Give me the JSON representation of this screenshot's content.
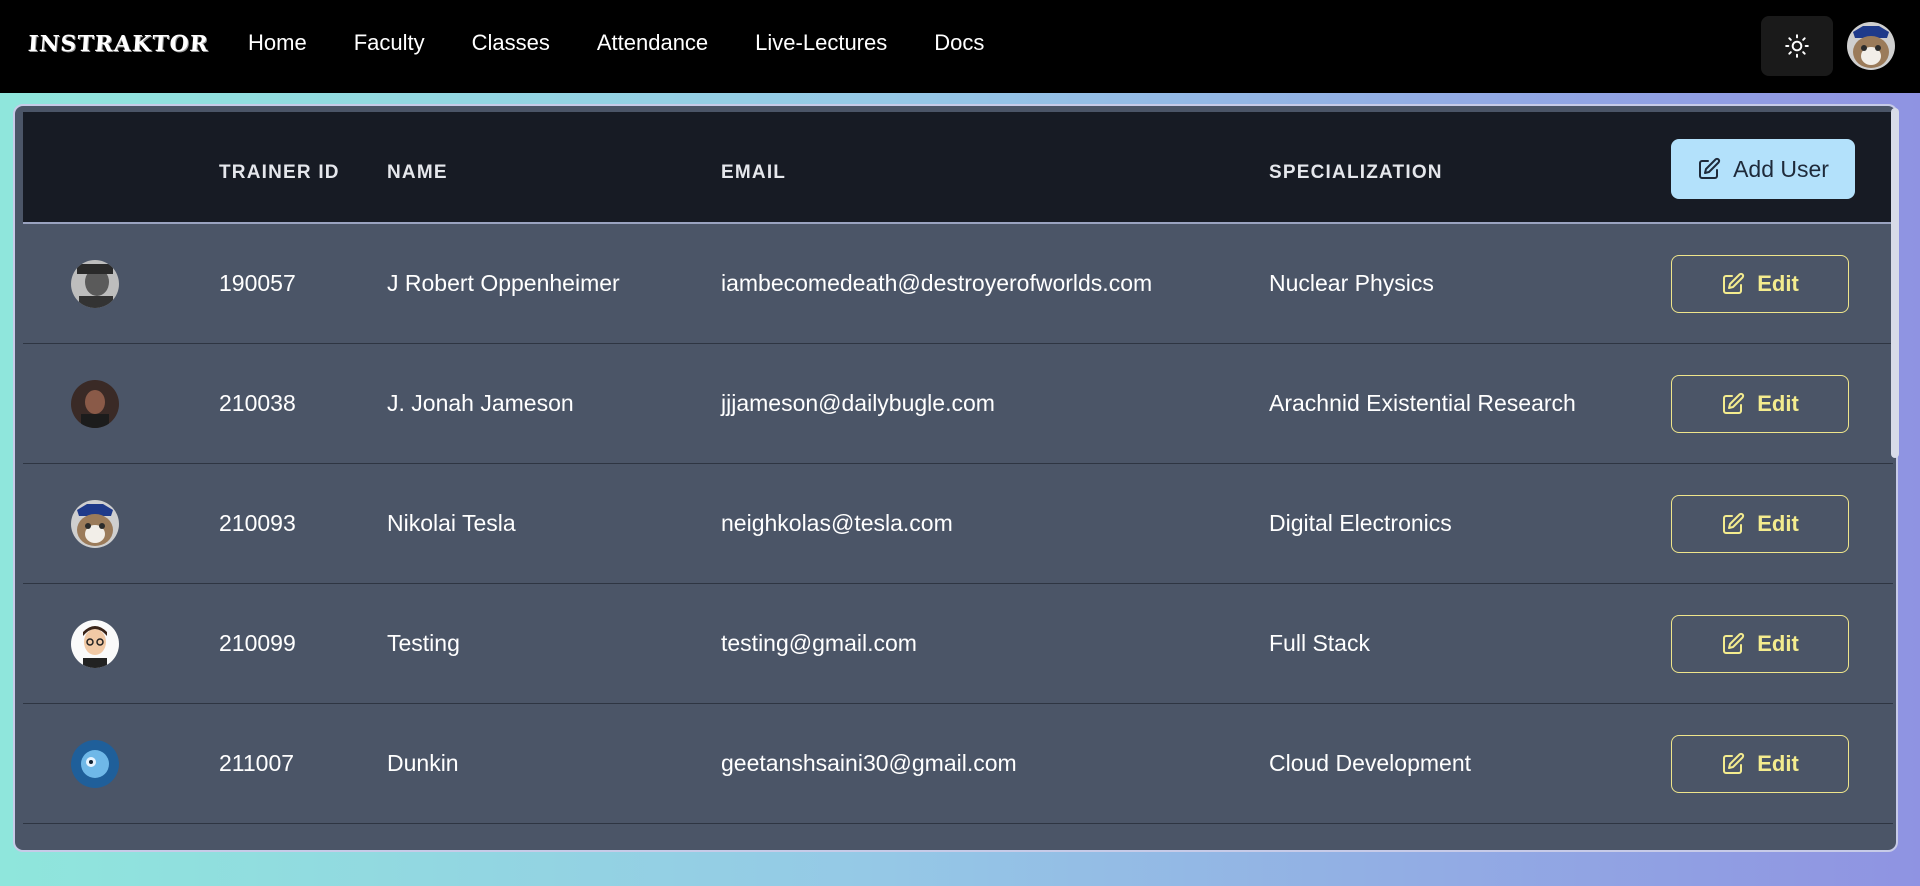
{
  "app": {
    "logo": "INSTRAKTOR"
  },
  "nav": {
    "items": [
      "Home",
      "Faculty",
      "Classes",
      "Attendance",
      "Live-Lectures",
      "Docs"
    ]
  },
  "icons": {
    "theme": "sun-icon",
    "edit": "edit-icon"
  },
  "colors": {
    "navbar_bg": "#000000",
    "table_header_bg": "#171b24",
    "row_bg": "#4b5567",
    "add_user_bg": "#b3e1fb",
    "edit_accent": "#f4ec8e"
  },
  "table": {
    "headers": {
      "trainer_id": "TRAINER ID",
      "name": "NAME",
      "email": "EMAIL",
      "specialization": "SPECIALIZATION"
    },
    "add_user_label": "Add User",
    "edit_label": "Edit",
    "rows": [
      {
        "id": "190057",
        "name": "J Robert Oppenheimer",
        "email": "iambecomedeath@destroyerofworlds.com",
        "specialization": "Nuclear Physics"
      },
      {
        "id": "210038",
        "name": "J. Jonah Jameson",
        "email": "jjjameson@dailybugle.com",
        "specialization": "Arachnid Existential Research"
      },
      {
        "id": "210093",
        "name": "Nikolai Tesla",
        "email": "neighkolas@tesla.com",
        "specialization": "Digital Electronics"
      },
      {
        "id": "210099",
        "name": "Testing",
        "email": "testing@gmail.com",
        "specialization": "Full Stack"
      },
      {
        "id": "211007",
        "name": "Dunkin",
        "email": "geetanshsaini30@gmail.com",
        "specialization": "Cloud Development"
      }
    ]
  }
}
